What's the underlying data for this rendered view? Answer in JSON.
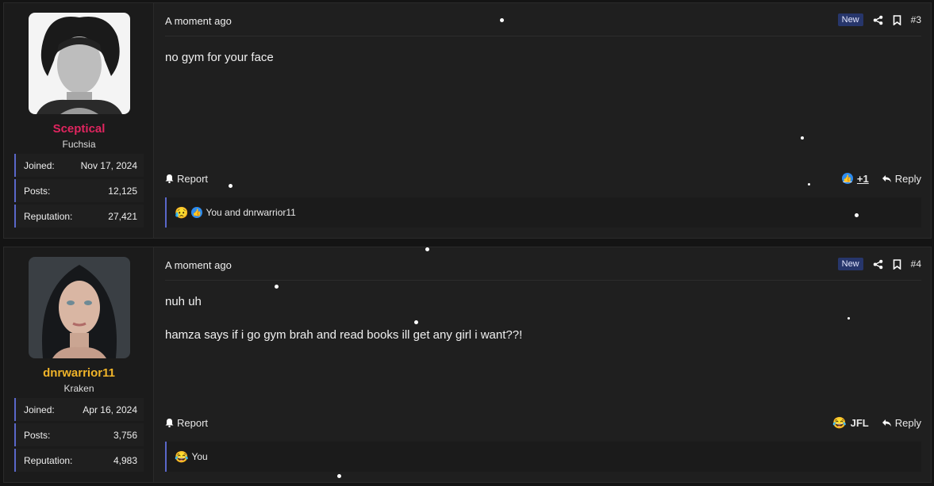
{
  "posts": [
    {
      "username": "Sceptical",
      "username_color": "#e0255f",
      "user_title": "Fuchsia",
      "stats": [
        {
          "label": "Joined:",
          "value": "Nov 17, 2024"
        },
        {
          "label": "Posts:",
          "value": "12,125"
        },
        {
          "label": "Reputation:",
          "value": "27,421"
        }
      ],
      "time": "A moment ago",
      "badge": "New",
      "post_number": "#3",
      "body": [
        "no gym for your face"
      ],
      "report": "Report",
      "reaction_summary": "+1",
      "reply": "Reply",
      "reaction_text": "You and dnrwarrior11"
    },
    {
      "username": "dnrwarrior11",
      "username_color": "#f0b429",
      "user_title": "Kraken",
      "stats": [
        {
          "label": "Joined:",
          "value": "Apr 16, 2024"
        },
        {
          "label": "Posts:",
          "value": "3,756"
        },
        {
          "label": "Reputation:",
          "value": "4,983"
        }
      ],
      "time": "A moment ago",
      "badge": "New",
      "post_number": "#4",
      "body": [
        "nuh uh",
        "hamza says if i go gym brah and read books ill get any girl i want??!"
      ],
      "report": "Report",
      "reaction_summary": "JFL",
      "reply": "Reply",
      "reaction_text": "You"
    }
  ],
  "icons": [
    "share-icon",
    "bookmark-icon",
    "bell-icon",
    "like-icon",
    "reply-icon",
    "laugh-emoji-icon",
    "sad-emoji-icon"
  ]
}
